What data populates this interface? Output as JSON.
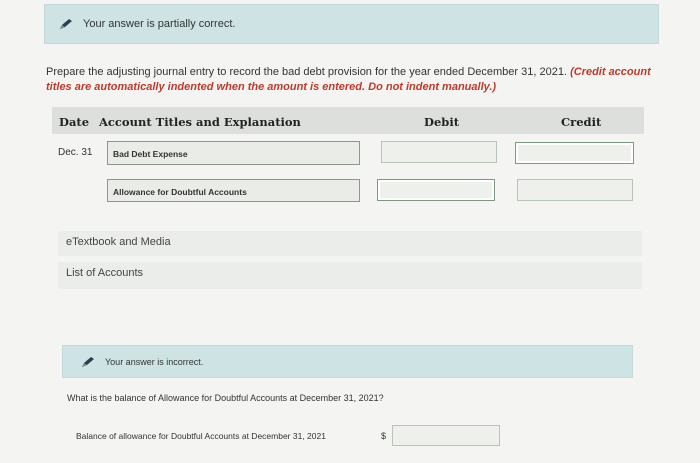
{
  "status_top": {
    "text": "Your answer is partially correct."
  },
  "prompt": {
    "main": "Prepare the adjusting journal entry to record the bad debt provision for the year ended December 31, 2021.",
    "note": "(Credit account titles are automatically indented when the amount is entered. Do not indent manually.)"
  },
  "table": {
    "headers": {
      "date": "Date",
      "account": "Account Titles and Explanation",
      "debit": "Debit",
      "credit": "Credit"
    },
    "rows": [
      {
        "date": "Dec. 31",
        "account": "Bad Debt Expense",
        "debit": "",
        "credit": ""
      },
      {
        "date": "",
        "account": "Allowance for Doubtful Accounts",
        "debit": "",
        "credit": ""
      }
    ]
  },
  "links": {
    "etextbook": "eTextbook and Media",
    "accounts": "List of Accounts"
  },
  "status_bottom": {
    "text": "Your answer is incorrect."
  },
  "question": {
    "text": "What is the balance of Allowance for Doubtful Accounts at December 31, 2021?"
  },
  "answer": {
    "label": "Balance of allowance for Doubtful Accounts at December 31, 2021",
    "currency": "$",
    "value": ""
  },
  "colors": {
    "banner": "#cde3e4",
    "note": "#c0392b",
    "header": "#dddfdc"
  }
}
